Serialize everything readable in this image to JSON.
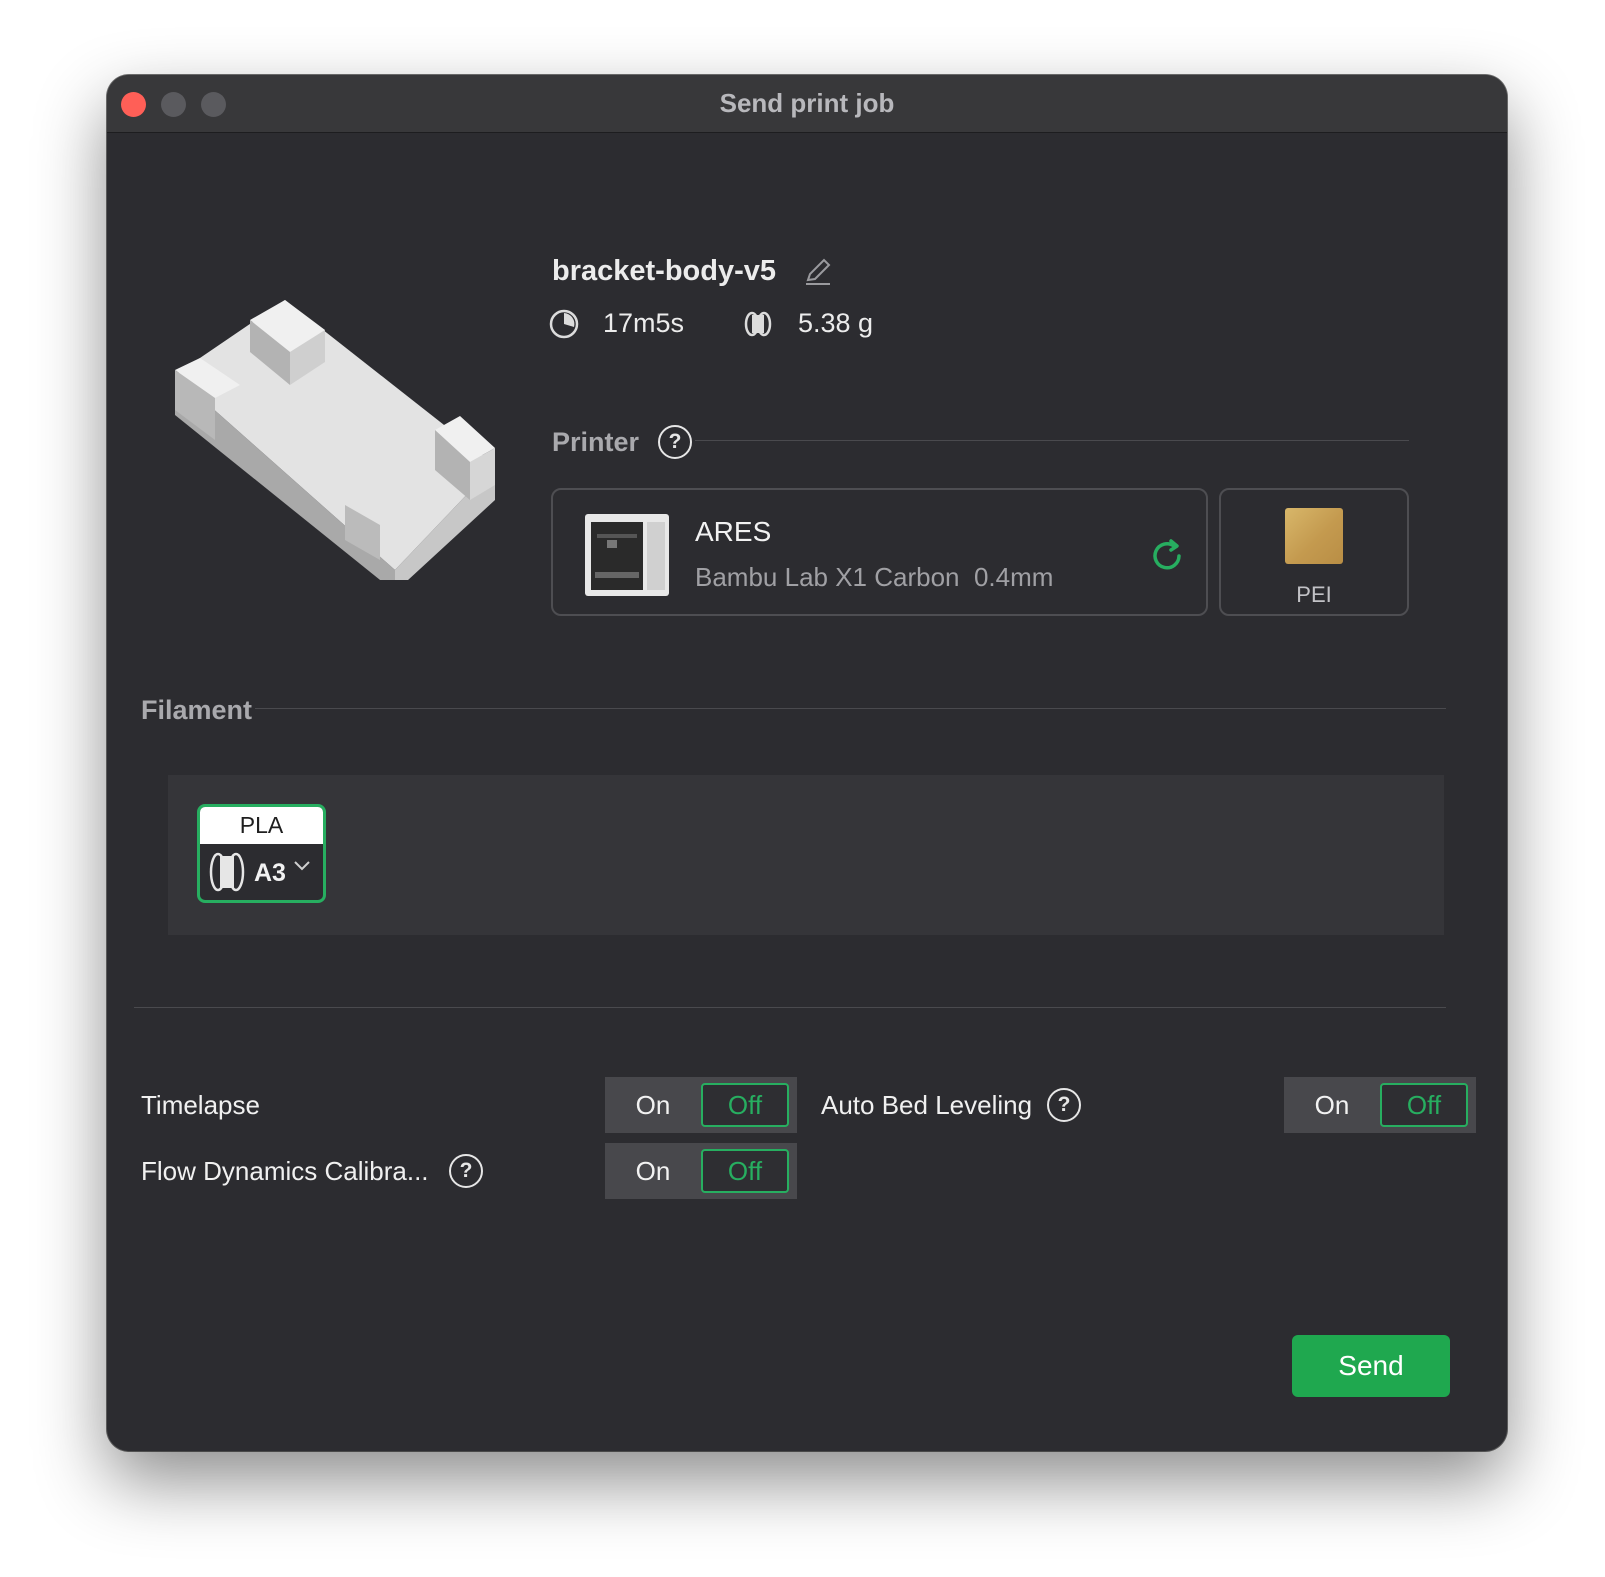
{
  "window": {
    "title": "Send print job"
  },
  "job": {
    "name": "bracket-body-v5",
    "time": "17m5s",
    "weight": "5.38 g"
  },
  "printer_section": {
    "label": "Printer",
    "printer": {
      "name": "ARES",
      "model": "Bambu Lab X1 Carbon",
      "nozzle": "0.4mm"
    },
    "plate": {
      "label": "PEI"
    }
  },
  "filament_section": {
    "label": "Filament",
    "slots": [
      {
        "type": "PLA",
        "slot_id": "A3"
      }
    ]
  },
  "options": {
    "timelapse": {
      "label": "Timelapse",
      "on": "On",
      "off": "Off",
      "selected": "Off"
    },
    "auto_bed_leveling": {
      "label": "Auto Bed Leveling",
      "on": "On",
      "off": "Off",
      "selected": "Off"
    },
    "flow_dynamics": {
      "label": "Flow Dynamics Calibra...",
      "on": "On",
      "off": "Off",
      "selected": "Off"
    }
  },
  "send_button": "Send",
  "icons": {
    "help": "question-circle-icon",
    "edit": "pencil-icon",
    "time": "clock-icon",
    "weight": "spool-icon",
    "refresh": "refresh-icon"
  },
  "colors": {
    "accent": "#27ae60",
    "send": "#1fa84f",
    "background": "#2c2c30"
  }
}
